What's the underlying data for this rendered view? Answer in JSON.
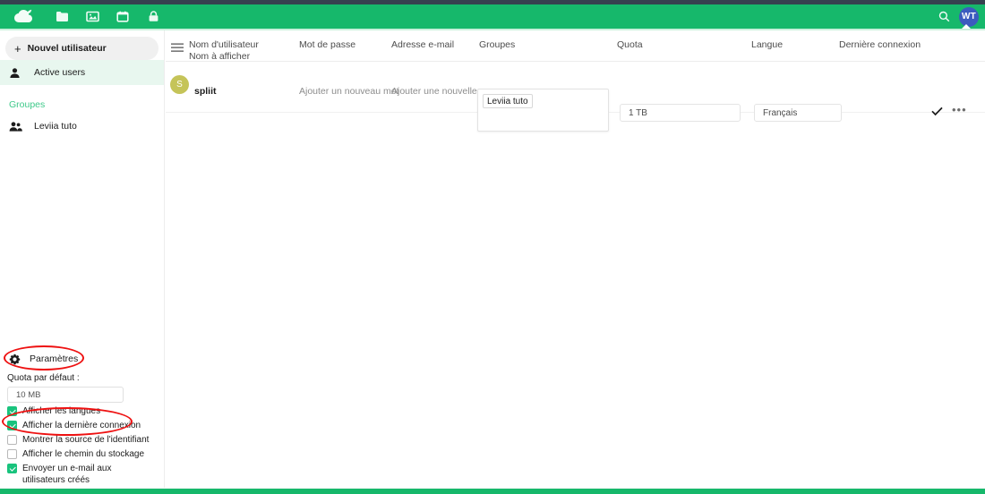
{
  "header": {
    "logo_name": "nextcloud-cloud-logo",
    "nav_icons": [
      {
        "name": "folder-icon",
        "label": "Fichiers"
      },
      {
        "name": "photos-icon",
        "label": "Photos"
      },
      {
        "name": "calendar-icon",
        "label": "Agenda"
      },
      {
        "name": "passwords-lock-icon",
        "label": "Mots de passe"
      }
    ],
    "search_icon": "search-icon",
    "avatar_initials": "WT",
    "avatar_color": "#3c5bbf",
    "brand_color": "#16b86b"
  },
  "sidebar": {
    "new_user_label": "Nouvel utilisateur",
    "new_user_plus": "+",
    "items": [
      {
        "label": "Active users",
        "icon": "user-icon",
        "active": true
      }
    ],
    "groups_header": "Groupes",
    "groups": [
      {
        "label": "Leviia tuto",
        "icon": "group-icon"
      }
    ],
    "settings": {
      "label": "Paramètres",
      "icon": "gear-icon",
      "quota_label": "Quota par défaut :",
      "quota_value": "10 MB",
      "checkboxes": [
        {
          "label": "Afficher les langues",
          "checked": true
        },
        {
          "label": "Afficher la dernière connexion",
          "checked": true
        },
        {
          "label": "Montrer la source de l'identifiant",
          "checked": false
        },
        {
          "label": "Afficher le chemin du stockage",
          "checked": false
        },
        {
          "label": "Envoyer un e-mail aux utilisateurs créés",
          "checked": true
        }
      ]
    }
  },
  "table": {
    "list_icon": "list-view-icon",
    "columns": {
      "username_line1": "Nom d'utilisateur",
      "username_line2": "Nom à afficher",
      "password": "Mot de passe",
      "email": "Adresse e-mail",
      "groups": "Groupes",
      "quota": "Quota",
      "language": "Langue",
      "last_login": "Dernière connexion"
    },
    "rows": [
      {
        "avatar_initial": "S",
        "avatar_color": "#c5c459",
        "username": "spliit",
        "password_placeholder": "Ajouter un nouveau mot",
        "email_placeholder": "Ajouter une nouvelle ...",
        "group_chip": "Leviia tuto",
        "quota": "1 TB",
        "language": "Français",
        "confirm_icon": "check-icon",
        "menu_icon": "more-actions-icon",
        "menu_glyph": "•••"
      }
    ]
  },
  "annotations": {
    "color": "#ee1111",
    "shapes": [
      "ellipse-around-parametres",
      "ellipse-around-display-checkboxes"
    ]
  }
}
